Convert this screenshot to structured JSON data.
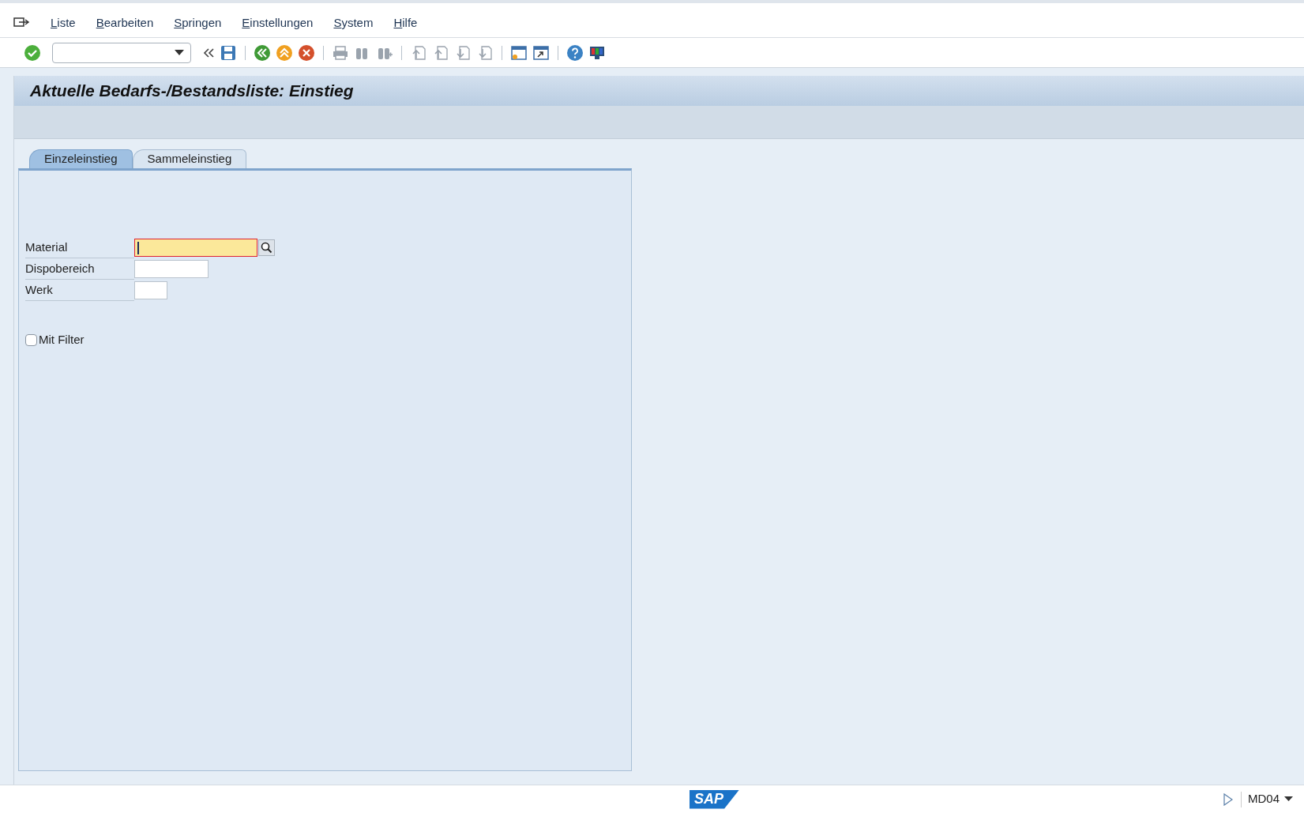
{
  "menu": [
    {
      "label": "Liste"
    },
    {
      "label": "Bearbeiten"
    },
    {
      "label": "Springen"
    },
    {
      "label": "Einstellungen"
    },
    {
      "label": "System"
    },
    {
      "label": "Hilfe"
    }
  ],
  "toolbar": [
    {
      "kind": "enter",
      "disabled": false
    },
    {
      "kind": "command"
    },
    {
      "kind": "collapse",
      "disabled": false
    },
    {
      "kind": "save",
      "disabled": false
    },
    {
      "kind": "sep"
    },
    {
      "kind": "back",
      "disabled": false
    },
    {
      "kind": "exit",
      "disabled": false
    },
    {
      "kind": "cancel",
      "disabled": false
    },
    {
      "kind": "sep"
    },
    {
      "kind": "print",
      "disabled": true
    },
    {
      "kind": "find",
      "disabled": true
    },
    {
      "kind": "findnext",
      "disabled": true
    },
    {
      "kind": "sep"
    },
    {
      "kind": "first",
      "disabled": true
    },
    {
      "kind": "prev",
      "disabled": true
    },
    {
      "kind": "next",
      "disabled": true
    },
    {
      "kind": "last",
      "disabled": true
    },
    {
      "kind": "sep"
    },
    {
      "kind": "session",
      "disabled": false
    },
    {
      "kind": "shortcut",
      "disabled": false
    },
    {
      "kind": "sep"
    },
    {
      "kind": "help",
      "disabled": false
    },
    {
      "kind": "layout",
      "disabled": false
    }
  ],
  "title": "Aktuelle Bedarfs-/Bestandsliste: Einstieg",
  "tabs": [
    {
      "label": "Einzeleinstieg",
      "selected": true
    },
    {
      "label": "Sammeleinstieg",
      "selected": false
    }
  ],
  "fields": [
    {
      "label": "Material",
      "focused": true,
      "search_help": true
    },
    {
      "label": "Dispobereich",
      "focused": false,
      "search_help": false
    },
    {
      "label": "Werk",
      "focused": false,
      "search_help": false
    }
  ],
  "filter": {
    "label": "Mit Filter",
    "checked": false
  },
  "status_bar": {
    "logo": "SAP",
    "transaction": "MD04"
  }
}
